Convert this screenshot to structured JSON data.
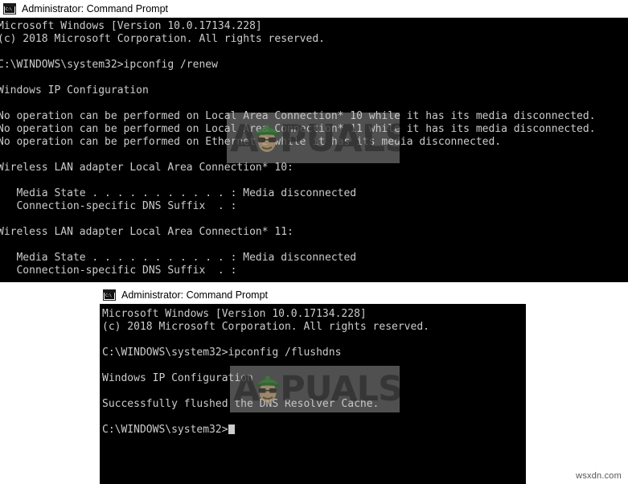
{
  "windows": [
    {
      "id": "top",
      "title": "Administrator: Command Prompt",
      "icon": "command-prompt-icon",
      "icon_glyph": "C:\\",
      "lines": [
        "Microsoft Windows [Version 10.0.17134.228]",
        "(c) 2018 Microsoft Corporation. All rights reserved.",
        "",
        "C:\\WINDOWS\\system32>ipconfig /renew",
        "",
        "Windows IP Configuration",
        "",
        "No operation can be performed on Local Area Connection* 10 while it has its media disconnected.",
        "No operation can be performed on Local Area Connection* 11 while it has its media disconnected.",
        "No operation can be performed on Ethernet 2 while it has its media disconnected.",
        "",
        "Wireless LAN adapter Local Area Connection* 10:",
        "",
        "   Media State . . . . . . . . . . . : Media disconnected",
        "   Connection-specific DNS Suffix  . :",
        "",
        "Wireless LAN adapter Local Area Connection* 11:",
        "",
        "   Media State . . . . . . . . . . . : Media disconnected",
        "   Connection-specific DNS Suffix  . :"
      ]
    },
    {
      "id": "bottom",
      "title": "Administrator: Command Prompt",
      "icon": "command-prompt-icon",
      "icon_glyph": "C:\\",
      "lines": [
        "Microsoft Windows [Version 10.0.17134.228]",
        "(c) 2018 Microsoft Corporation. All rights reserved.",
        "",
        "C:\\WINDOWS\\system32>ipconfig /flushdns",
        "",
        "Windows IP Configuration",
        "",
        "Successfully flushed the DNS Resolver Cache.",
        ""
      ],
      "prompt": "C:\\WINDOWS\\system32>",
      "cursor": "block-cursor"
    }
  ],
  "watermark": {
    "letter": "A",
    "text": "PUALS",
    "mascot": "appuals-mascot",
    "colors": {
      "overlay": "#bebebe",
      "text": "#2d2d2d",
      "hat": "#3c7a3c",
      "face": "#c4a882",
      "glasses": "#262626"
    }
  },
  "footer": {
    "credit": "wsxdn.com"
  },
  "theme": {
    "console_background": "#000000",
    "console_text": "#cccccc",
    "titlebar_background": "#ffffff",
    "titlebar_text": "#000000",
    "page_background": "#ffffff"
  }
}
